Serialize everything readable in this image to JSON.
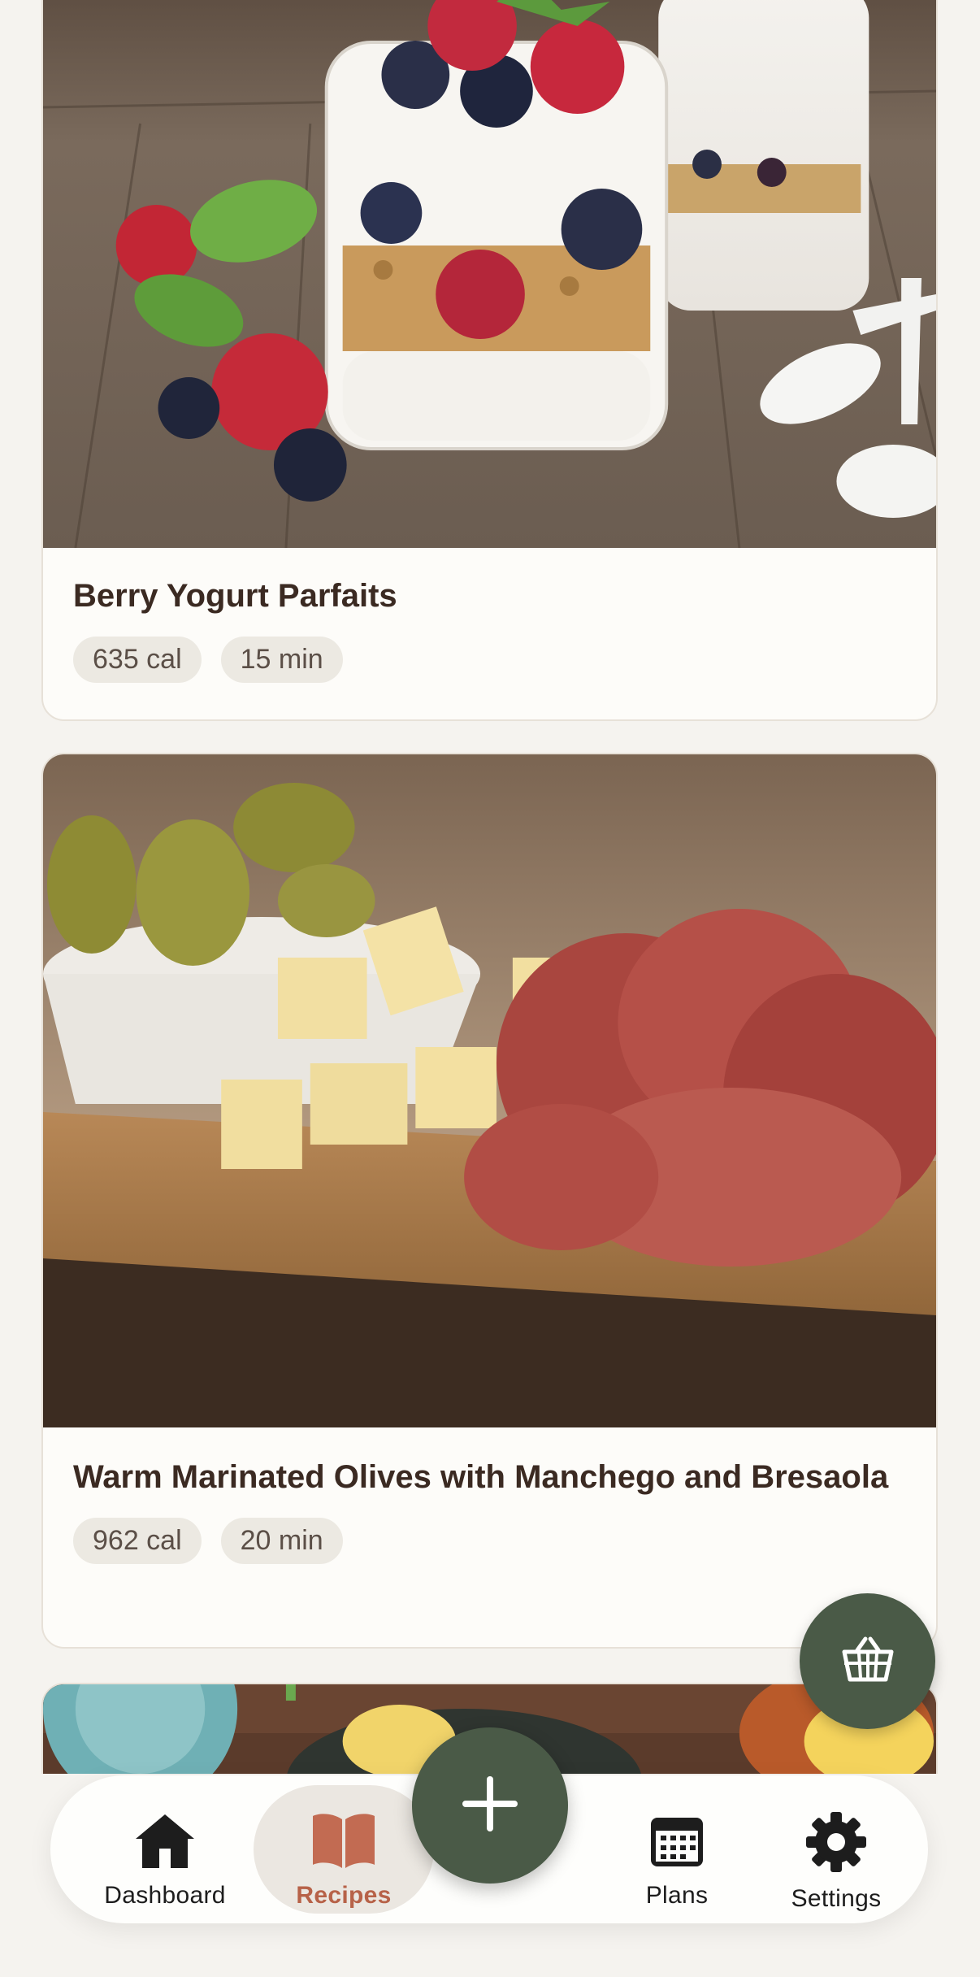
{
  "recipes": [
    {
      "title": "Berry Yogurt Parfaits",
      "calories": "635 cal",
      "time": "15 min"
    },
    {
      "title": "Warm Marinated Olives with Manchego and Bresaola",
      "calories": "962 cal",
      "time": "20 min"
    }
  ],
  "actions": {
    "cart_icon": "basket-icon",
    "add_icon": "plus-icon"
  },
  "tabs": [
    {
      "label": "Dashboard",
      "icon": "home-icon"
    },
    {
      "label": "Recipes",
      "icon": "book-icon",
      "active": true
    },
    {
      "label": "Plans",
      "icon": "calendar-icon"
    },
    {
      "label": "Settings",
      "icon": "gear-icon"
    }
  ],
  "colors": {
    "accent": "#4a5a47",
    "active_tab_text": "#b76248",
    "active_tab_bg": "#ebe7e1",
    "background": "#f5f3ef",
    "card": "#fdfcf9",
    "tag_bg": "#ece9e2"
  }
}
